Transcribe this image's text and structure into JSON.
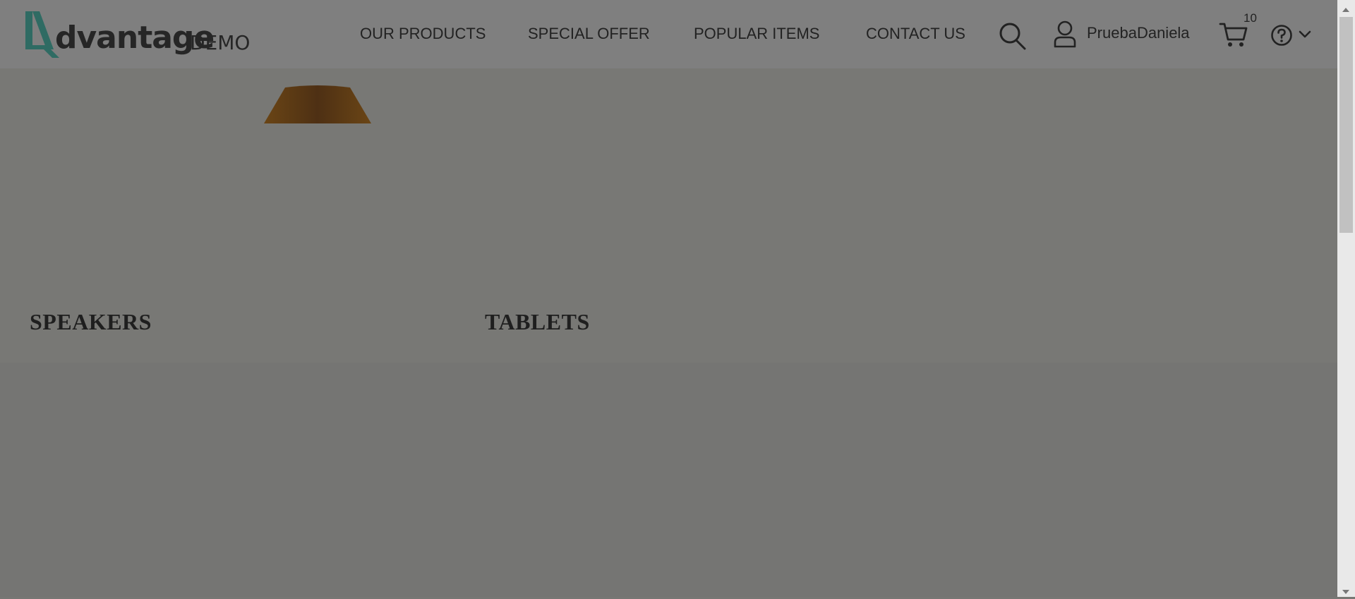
{
  "logo": {
    "word": "dvantage",
    "suffix": "DEMO"
  },
  "nav": {
    "items": [
      {
        "label": "OUR PRODUCTS"
      },
      {
        "label": "SPECIAL OFFER"
      },
      {
        "label": "POPULAR ITEMS"
      },
      {
        "label": "CONTACT US"
      }
    ]
  },
  "user": {
    "name": "PruebaDaniela"
  },
  "cart": {
    "count": "10"
  },
  "icons": {
    "search": "search-icon",
    "user": "user-icon",
    "cart": "cart-icon",
    "help": "help-icon",
    "dropdown": "chevron-down-icon"
  },
  "categories": [
    {
      "label": "SPEAKERS"
    },
    {
      "label": "TABLETS"
    }
  ],
  "colors": {
    "overlay": "#777774",
    "logo_accent": "#2f6b63",
    "lamp": "#5a3a15"
  }
}
